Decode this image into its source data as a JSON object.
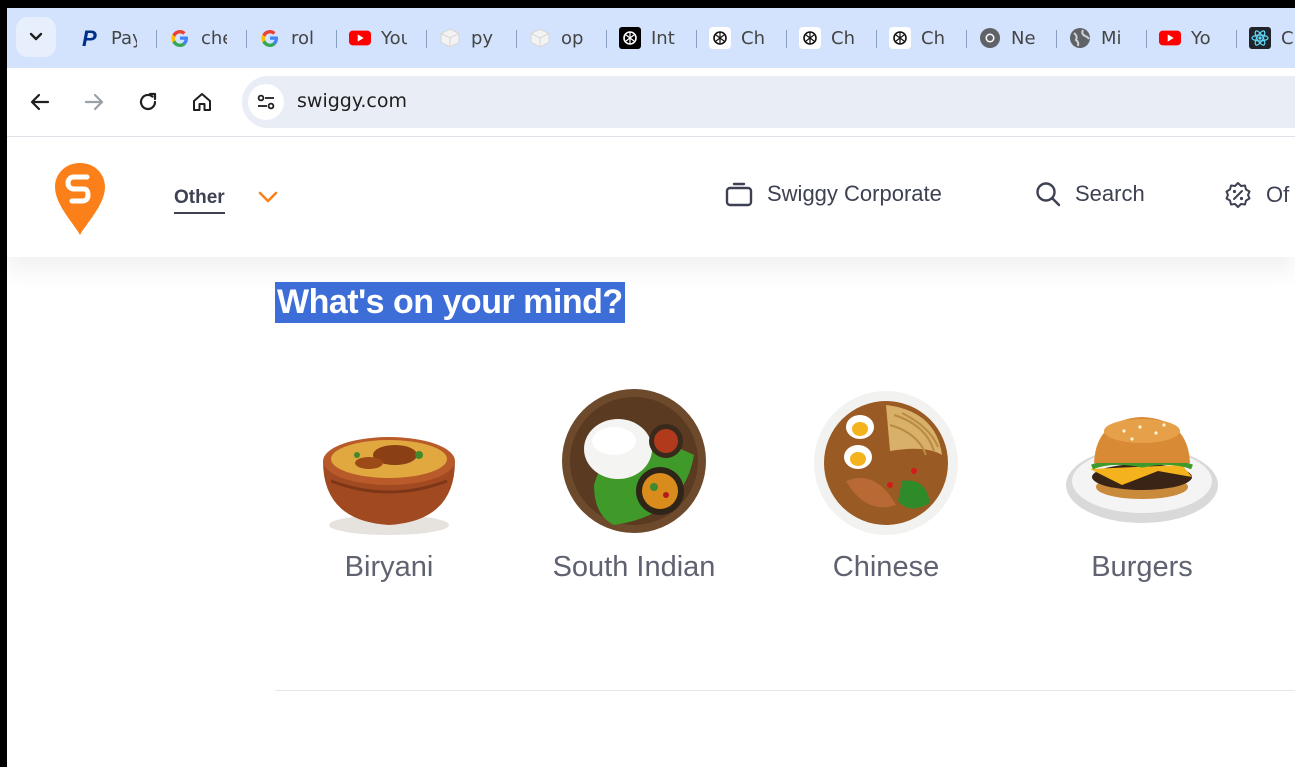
{
  "browser": {
    "tabs": [
      {
        "title": "Pay",
        "icon": "paypal-icon"
      },
      {
        "title": "che",
        "icon": "google-icon"
      },
      {
        "title": "rol",
        "icon": "google-icon"
      },
      {
        "title": "You",
        "icon": "youtube-icon"
      },
      {
        "title": "py",
        "icon": "cube-icon"
      },
      {
        "title": "op",
        "icon": "cube-icon"
      },
      {
        "title": "Int",
        "icon": "openai-dark-icon"
      },
      {
        "title": "Ch",
        "icon": "openai-icon"
      },
      {
        "title": "Ch",
        "icon": "openai-icon"
      },
      {
        "title": "Ch",
        "icon": "openai-icon"
      },
      {
        "title": "Ne",
        "icon": "chrome-icon"
      },
      {
        "title": "Mi",
        "icon": "globe-icon"
      },
      {
        "title": "Yo",
        "icon": "youtube-icon"
      },
      {
        "title": "C",
        "icon": "react-icon"
      }
    ],
    "url": "swiggy.com"
  },
  "site": {
    "brand_color": "#fc8019",
    "location_label": "Other",
    "nav": {
      "corporate": "Swiggy Corporate",
      "search": "Search",
      "offers": "Of"
    },
    "section_title": "What's on your mind?",
    "cuisines": [
      {
        "label": "Biryani"
      },
      {
        "label": "South Indian"
      },
      {
        "label": "Chinese"
      },
      {
        "label": "Burgers"
      }
    ]
  }
}
